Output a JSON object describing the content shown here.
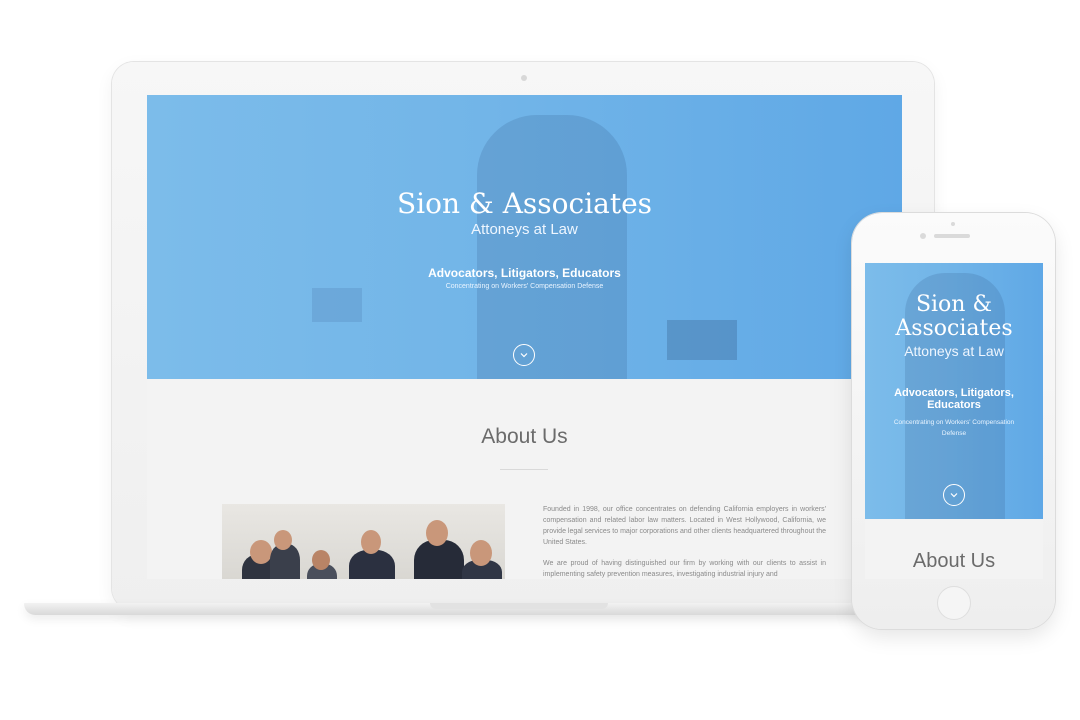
{
  "site": {
    "title": "Sion & Associates",
    "subtitle": "Attoneys at Law",
    "tagline": "Advocators, Litigators, Educators",
    "tagline_sub": "Concentrating on Workers' Compensation Defense",
    "scroll_icon": "chevron-down-icon",
    "about_heading": "About Us",
    "about_paragraphs": [
      "Founded in 1998, our office concentrates on defending California employers in workers' compensation and related labor law matters. Located in West Hollywood, California, we provide legal services to major corporations and other clients headquartered throughout the United States.",
      "We are proud of having distinguished our firm by working with our clients to assist in implementing safety prevention measures, investigating industrial injury and"
    ]
  },
  "colors": {
    "hero_blue": "#72b5e8",
    "background": "#f3f3f3",
    "device_frame": "#f2f2f2"
  }
}
